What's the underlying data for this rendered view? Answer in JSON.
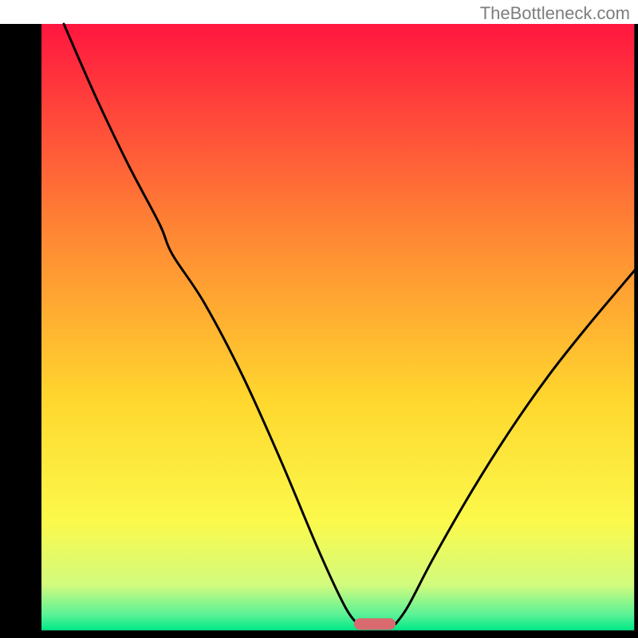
{
  "watermark": "TheBottleneck.com",
  "chart_data": {
    "type": "line",
    "title": "",
    "xlabel": "",
    "ylabel": "",
    "xlim": [
      0,
      100
    ],
    "ylim": [
      0,
      100
    ],
    "curve_left": [
      {
        "x": 10,
        "y": 100
      },
      {
        "x": 15,
        "y": 88
      },
      {
        "x": 20,
        "y": 77
      },
      {
        "x": 25,
        "y": 67
      },
      {
        "x": 27,
        "y": 62
      },
      {
        "x": 32,
        "y": 54
      },
      {
        "x": 38,
        "y": 42
      },
      {
        "x": 44,
        "y": 28
      },
      {
        "x": 50,
        "y": 13
      },
      {
        "x": 54,
        "y": 4
      },
      {
        "x": 56,
        "y": 1
      }
    ],
    "curve_right": [
      {
        "x": 62,
        "y": 1
      },
      {
        "x": 64,
        "y": 4
      },
      {
        "x": 68,
        "y": 12
      },
      {
        "x": 74,
        "y": 23
      },
      {
        "x": 80,
        "y": 33
      },
      {
        "x": 86,
        "y": 42
      },
      {
        "x": 92,
        "y": 50
      },
      {
        "x": 100,
        "y": 60
      }
    ],
    "marker": {
      "x_start": 55.5,
      "x_end": 62,
      "y": 1,
      "thickness": 1.8
    },
    "frame": {
      "left_border": 6.5,
      "right_border": 0.6,
      "bottom_border": 1.2
    },
    "background_gradient": [
      {
        "offset": 0.0,
        "color": "#ff163f"
      },
      {
        "offset": 0.34,
        "color": "#ff8534"
      },
      {
        "offset": 0.62,
        "color": "#ffd72e"
      },
      {
        "offset": 0.82,
        "color": "#fbf94b"
      },
      {
        "offset": 0.925,
        "color": "#d2fb7d"
      },
      {
        "offset": 0.975,
        "color": "#58f297"
      },
      {
        "offset": 1.0,
        "color": "#00e886"
      }
    ]
  }
}
